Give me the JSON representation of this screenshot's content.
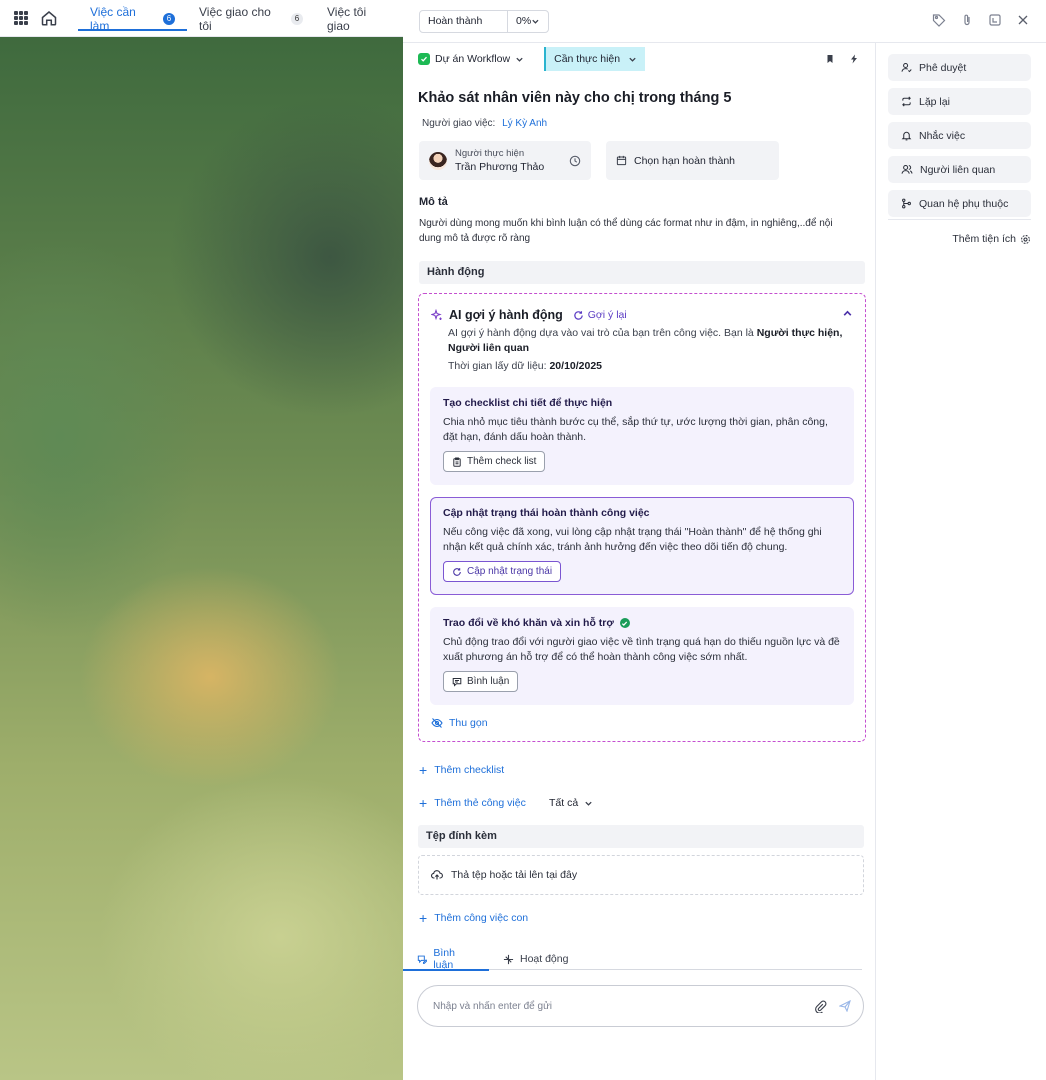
{
  "topbar": {
    "tabs": [
      {
        "label": "Việc cần làm",
        "badge": "6"
      },
      {
        "label": "Việc giao cho tôi",
        "badge": "6"
      },
      {
        "label": "Việc tôi giao",
        "badge": ""
      }
    ]
  },
  "panel": {
    "status": "Hoàn thành",
    "progress": "0%",
    "project": "Dự án Workflow",
    "state": "Cần thực hiện",
    "title": "Khảo sát nhân viên này cho chị trong tháng 5",
    "assigner_label": "Người giao việc:",
    "assigner_name": "Lý Kỳ Anh",
    "executor_label": "Người thực hiện",
    "executor_name": "Trần Phương Thảo",
    "deadline_label": "Chọn hạn hoàn thành",
    "description_heading": "Mô tả",
    "description": "Người dùng mong muốn khi bình luận có thể dùng các format như in đậm, in nghiêng,..để nội dung mô tả được rõ ràng",
    "actions_heading": "Hành động",
    "ai": {
      "title": "AI gợi ý hành động",
      "regen_label": "Gợi ý lại",
      "intro_prefix": "AI gợi ý hành động dựa vào vai trò của bạn trên công việc. Bạn là ",
      "intro_roles": "Người thực hiện, Người liên quan",
      "time_prefix": "Thời gian lấy dữ liệu: ",
      "time_value": "20/10/2025",
      "cards": [
        {
          "title": "Tạo checklist chi tiết để thực hiện",
          "desc": "Chia nhỏ mục tiêu thành bước cụ thể, sắp thứ tự, ước lượng thời gian, phân công, đặt hạn, đánh dấu hoàn thành.",
          "button": "Thêm check list"
        },
        {
          "title": "Cập nhật trạng thái hoàn thành công việc",
          "desc": "Nếu công việc đã xong, vui lòng cập nhật trạng thái \"Hoàn thành\" để hệ thống ghi nhận kết quả chính xác, tránh ảnh hưởng đến việc theo dõi tiến độ chung.",
          "button": "Cập nhật trạng thái"
        },
        {
          "title": "Trao đổi về khó khăn và xin hỗ trợ",
          "desc": "Chủ động trao đổi với người giao việc về tình trạng quá hạn do thiếu nguồn lực và đề xuất phương án hỗ trợ để có thể hoàn thành công việc sớm nhất.",
          "button": "Bình luận"
        }
      ],
      "collapse_label": "Thu gọn"
    },
    "add_checklist": "Thêm checklist",
    "add_tag": "Thêm thẻ công việc",
    "filter_all": "Tất cả",
    "attachments_heading": "Tệp đính kèm",
    "drop_label": "Thả tệp hoặc tải lên tại đây",
    "add_subtask": "Thêm công việc con",
    "tabs": [
      {
        "label": "Bình luận"
      },
      {
        "label": "Hoạt động"
      }
    ],
    "comment_placeholder": "Nhập và nhấn enter để gửi"
  },
  "sidebar": {
    "items": [
      {
        "label": "Phê duyệt",
        "icon": "user-check-icon"
      },
      {
        "label": "Lặp lại",
        "icon": "repeat-icon"
      },
      {
        "label": "Nhắc việc",
        "icon": "bell-icon"
      },
      {
        "label": "Người liên quan",
        "icon": "users-icon"
      },
      {
        "label": "Quan hệ phụ thuộc",
        "icon": "git-branch-icon"
      }
    ],
    "more_label": "Thêm tiện ích"
  },
  "colors": {
    "accent": "#1e6fd9",
    "ai_purple": "#5b3cc4",
    "ai_border": "#c44fd0",
    "state_bg": "#c9f1f8",
    "success": "#1a9c59"
  }
}
